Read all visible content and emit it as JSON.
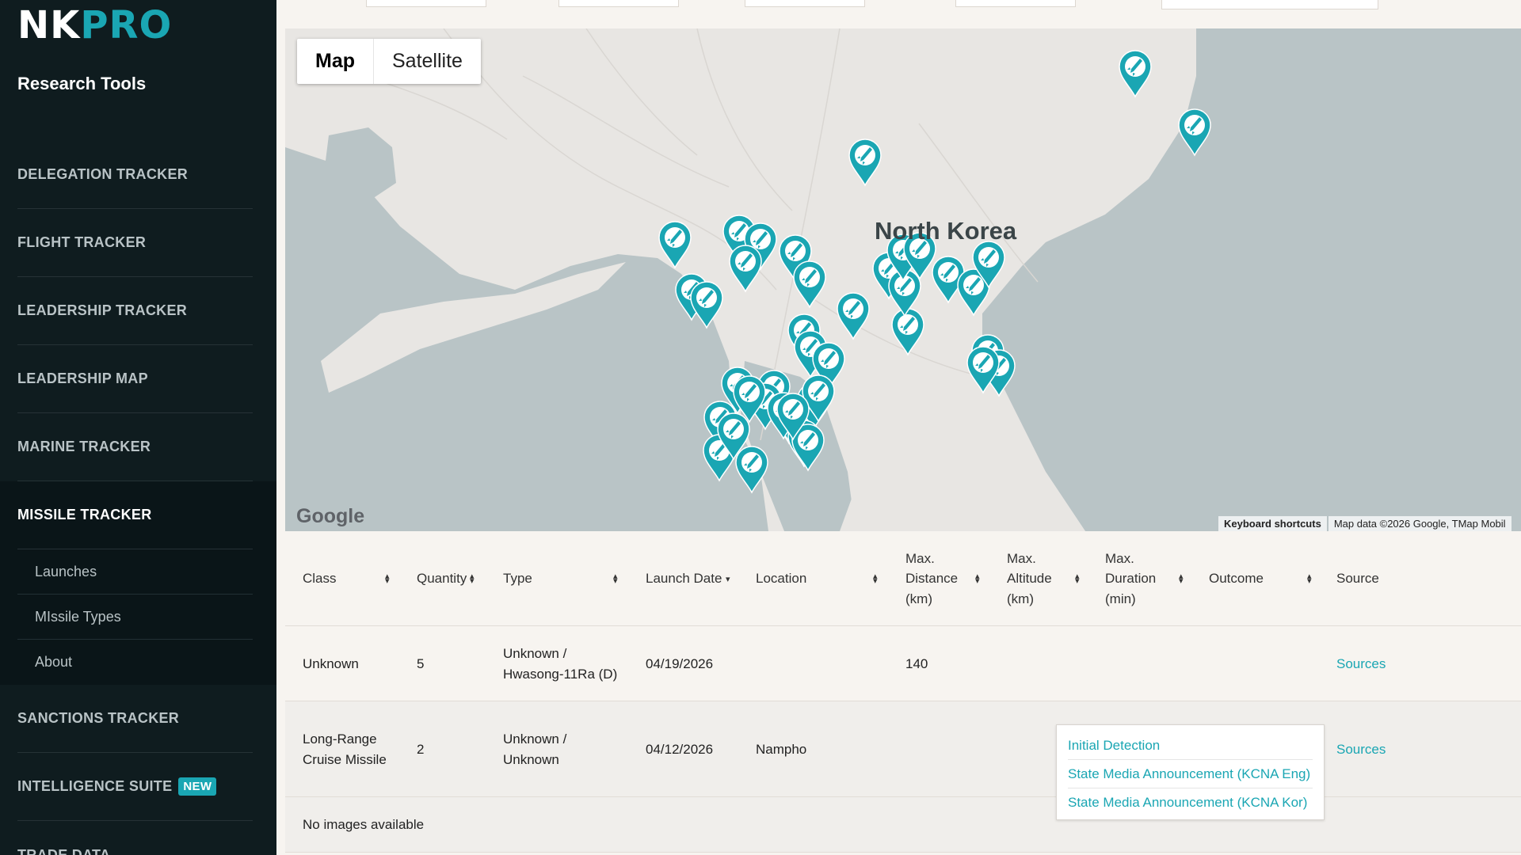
{
  "sidebar": {
    "logo_part1": "NK",
    "logo_part2": "PRO",
    "subtitle": "Research Tools",
    "items": [
      {
        "label": "DELEGATION TRACKER"
      },
      {
        "label": "FLIGHT TRACKER"
      },
      {
        "label": "LEADERSHIP TRACKER"
      },
      {
        "label": "LEADERSHIP MAP"
      },
      {
        "label": "MARINE TRACKER"
      },
      {
        "label": "MISSILE TRACKER"
      },
      {
        "label": "SANCTIONS TRACKER"
      },
      {
        "label": "INTELLIGENCE SUITE"
      },
      {
        "label": "TRADE DATA"
      }
    ],
    "active_index": 5,
    "submenu": [
      {
        "label": "Launches"
      },
      {
        "label": "MIssile Types"
      },
      {
        "label": "About"
      }
    ],
    "new_badge": "NEW"
  },
  "map": {
    "toggle": {
      "map": "Map",
      "satellite": "Satellite"
    },
    "country_label": "North Korea",
    "google_logo": "Google",
    "keyboard_shortcuts": "Keyboard shortcuts",
    "map_data": "Map data ©2026 Google, TMap Mobil",
    "marker_color": "#1aa6b3",
    "marker_icon": "missile-icon",
    "land_color": "#e8e6e3",
    "water_color": "#b9c4c6"
  },
  "table": {
    "headers": {
      "class": "Class",
      "quantity": "Quantity",
      "type": "Type",
      "launch_date": "Launch Date",
      "location": "Location",
      "max_distance": "Max. Distance (km)",
      "max_altitude": "Max. Altitude (km)",
      "max_duration": "Max. Duration (min)",
      "outcome": "Outcome",
      "source": "Source"
    },
    "rows": [
      {
        "class": "Unknown",
        "quantity": "5",
        "type": "Unknown / Hwasong-11Ra (D)",
        "launch_date": "04/19/2026",
        "location": "",
        "max_distance": "140",
        "source": "Sources"
      },
      {
        "class": "Long-Range Cruise Missile",
        "quantity": "2",
        "type": "Unknown / Unknown",
        "launch_date": "04/12/2026",
        "location": "Nampho",
        "max_distance": "",
        "source": "Sources"
      }
    ],
    "no_images": "No images available",
    "sources_popup": [
      {
        "label": "Initial Detection"
      },
      {
        "label": "State Media Announcement (KCNA Eng)"
      },
      {
        "label": "State Media Announcement (KCNA Kor)"
      }
    ]
  }
}
